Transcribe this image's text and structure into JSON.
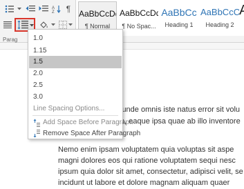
{
  "ribbon": {
    "group_label": "Parag",
    "pilcrow": "¶"
  },
  "styles": [
    {
      "preview": "AaBbCcDd",
      "name": "¶ Normal",
      "selected": true
    },
    {
      "preview": "AaBbCcDd",
      "name": "¶ No Spac...",
      "selected": false
    },
    {
      "preview": "AaBbCc",
      "name": "Heading 1",
      "selected": false
    },
    {
      "preview": "AaBbCcC",
      "name": "Heading 2",
      "selected": false
    },
    {
      "preview": "A",
      "name": "",
      "selected": false
    }
  ],
  "menu": {
    "spacing_values": [
      "1.0",
      "1.15",
      "1.5",
      "2.0",
      "2.5",
      "3.0"
    ],
    "selected_index": 2,
    "options_label": "Line Spacing Options...",
    "add_space_label": "Add Space Before Paragraph",
    "remove_space_label": "Remove Space After Paragraph"
  },
  "document": {
    "lines_top": [
      "iunde omnis iste natus error sit volu",
      "n, eaque ipsa quae ab illo inventore"
    ],
    "lines_bottom": [
      "Nemo enim ipsam voluptatem quia voluptas sit aspe",
      "magni dolores eos qui ratione voluptatem sequi nesc",
      "ipsum quia dolor sit amet, consectetur, adipisci velit, se",
      "incidunt ut labore et dolore magnam aliquam quaer"
    ]
  }
}
